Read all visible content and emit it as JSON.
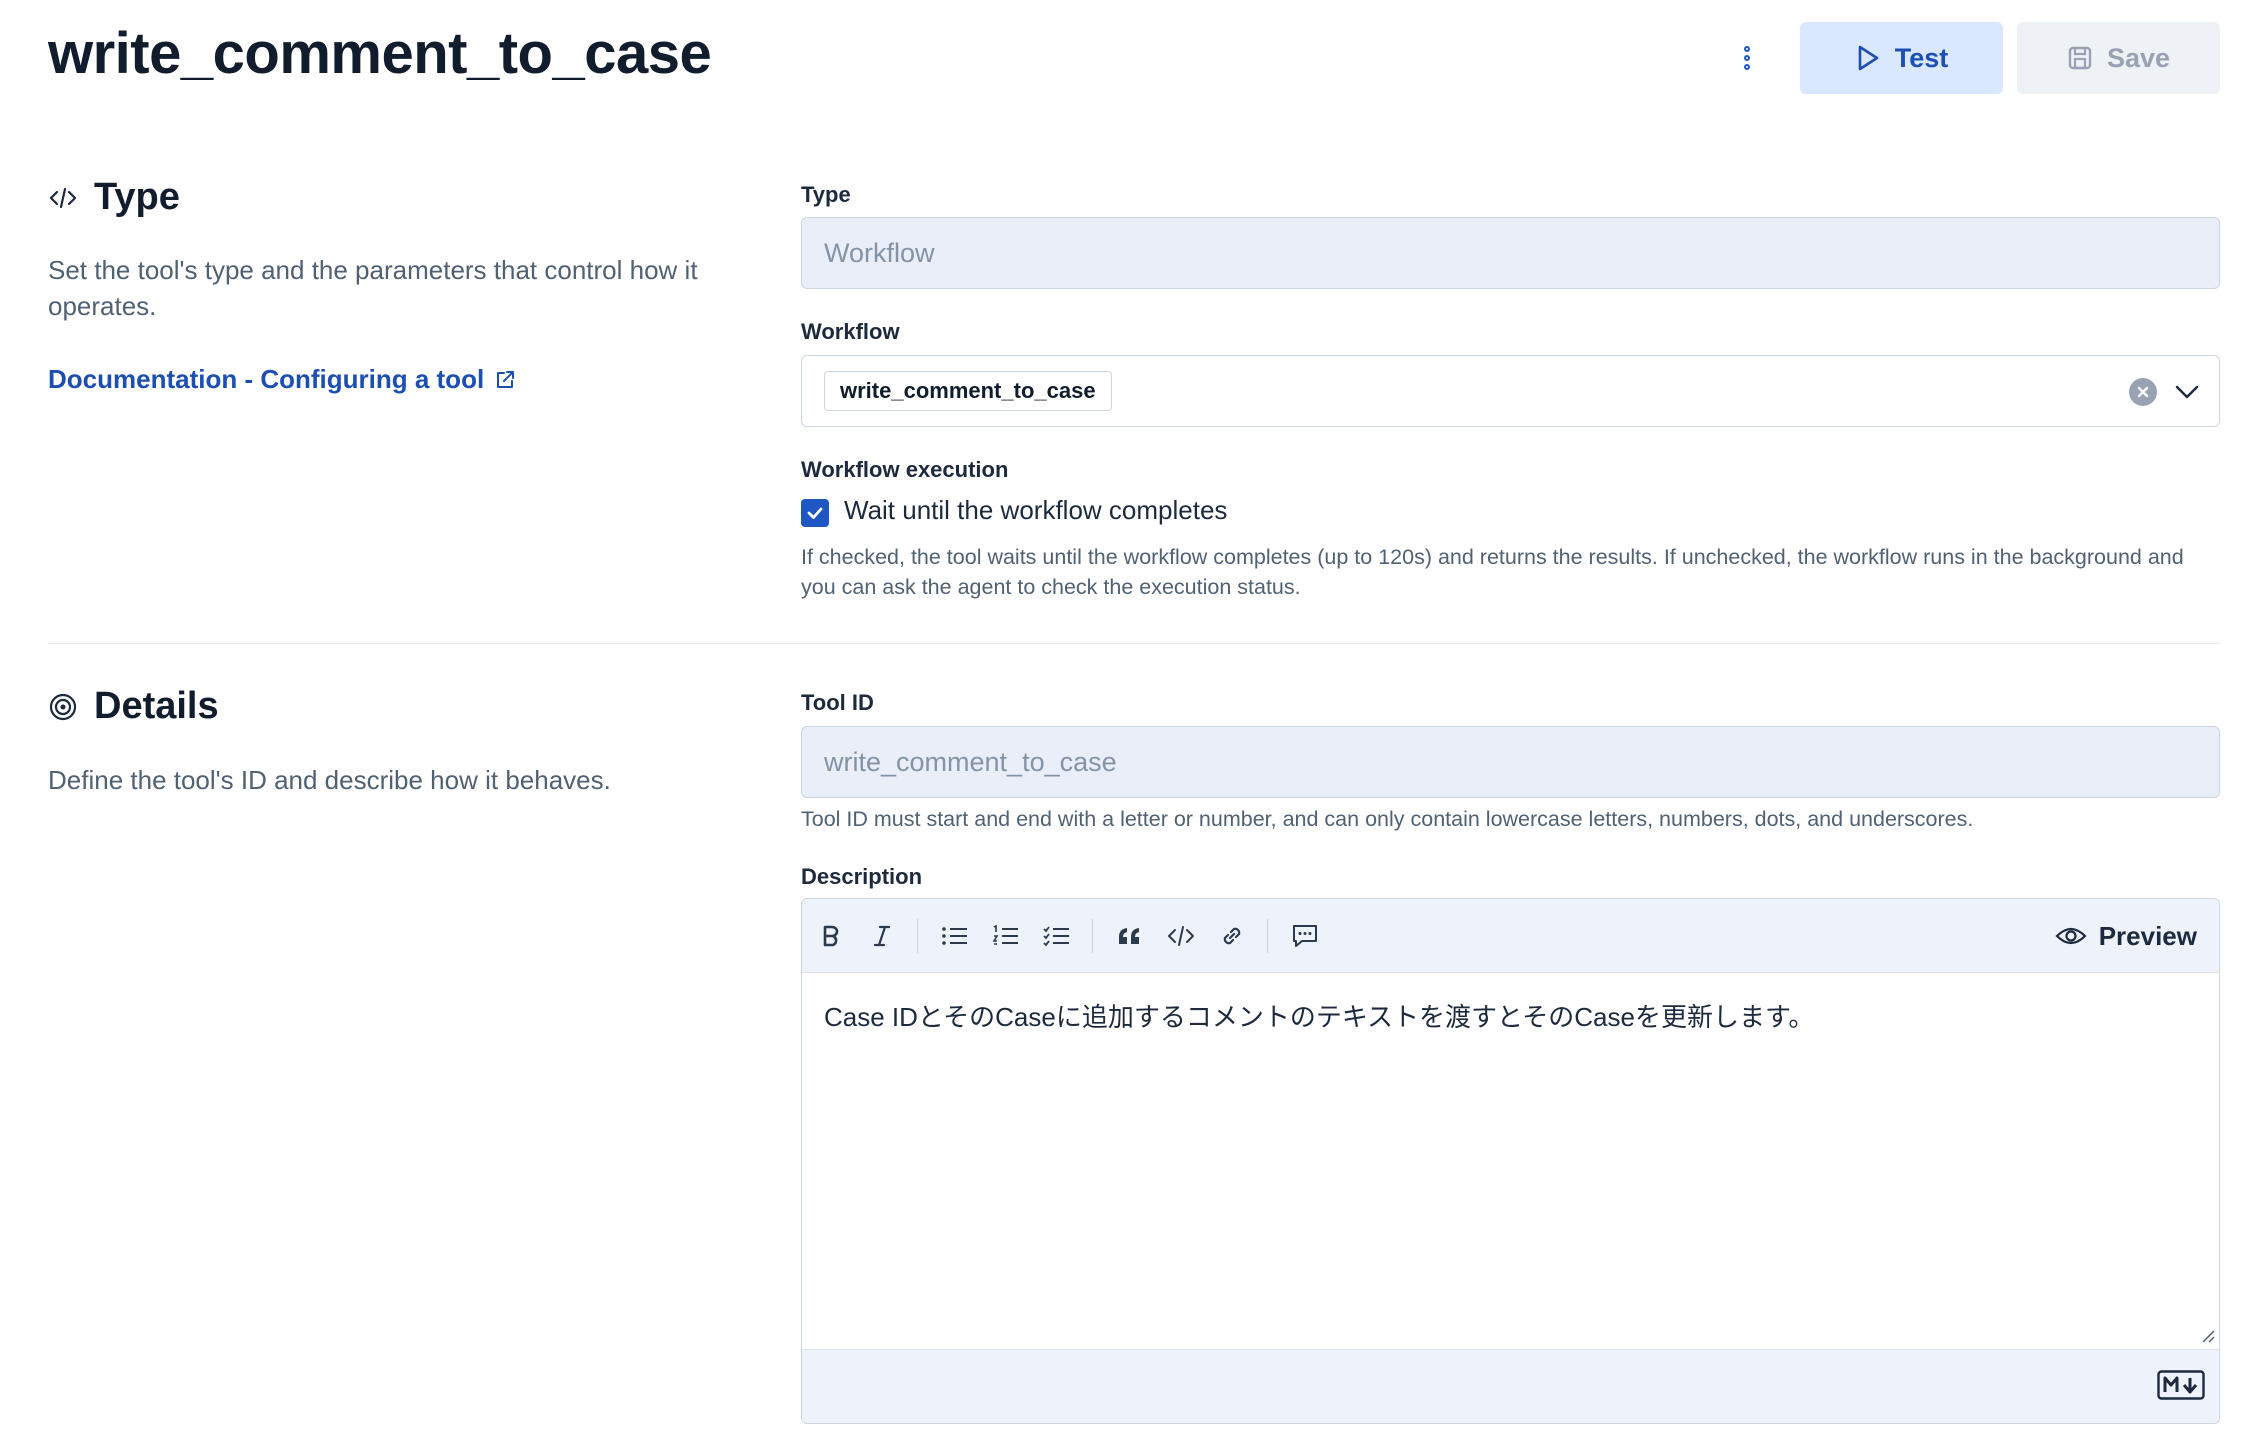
{
  "header": {
    "title": "write_comment_to_case",
    "more_icon": "vertical-ellipsis-icon",
    "test_label": "Test",
    "save_label": "Save"
  },
  "type_section": {
    "title": "Type",
    "icon": "code-icon",
    "description": "Set the tool's type and the parameters that control how it operates.",
    "doc_link": "Documentation - Configuring a tool",
    "type_label": "Type",
    "type_value": "Workflow",
    "workflow_label": "Workflow",
    "workflow_value": "write_comment_to_case",
    "execution_label": "Workflow execution",
    "wait_checkbox_label": "Wait until the workflow completes",
    "wait_checked": true,
    "wait_help": "If checked, the tool waits until the workflow completes (up to 120s) and returns the results. If unchecked, the workflow runs in the background and you can ask the agent to check the execution status."
  },
  "details_section": {
    "title": "Details",
    "icon": "target-icon",
    "description": "Define the tool's ID and describe how it behaves.",
    "tool_id_label": "Tool ID",
    "tool_id_value": "write_comment_to_case",
    "tool_id_help": "Tool ID must start and end with a letter or number, and can only contain lowercase letters, numbers, dots, and underscores.",
    "description_label": "Description",
    "preview_label": "Preview",
    "description_text": "Case IDとそのCaseに追加するコメントのテキストを渡すとそのCaseを更新します。"
  },
  "colors": {
    "accent": "#1f56c4",
    "link": "#1d4fb3",
    "test_button_bg": "#d9e7ff",
    "disabled_field_bg": "#e9eef8"
  }
}
